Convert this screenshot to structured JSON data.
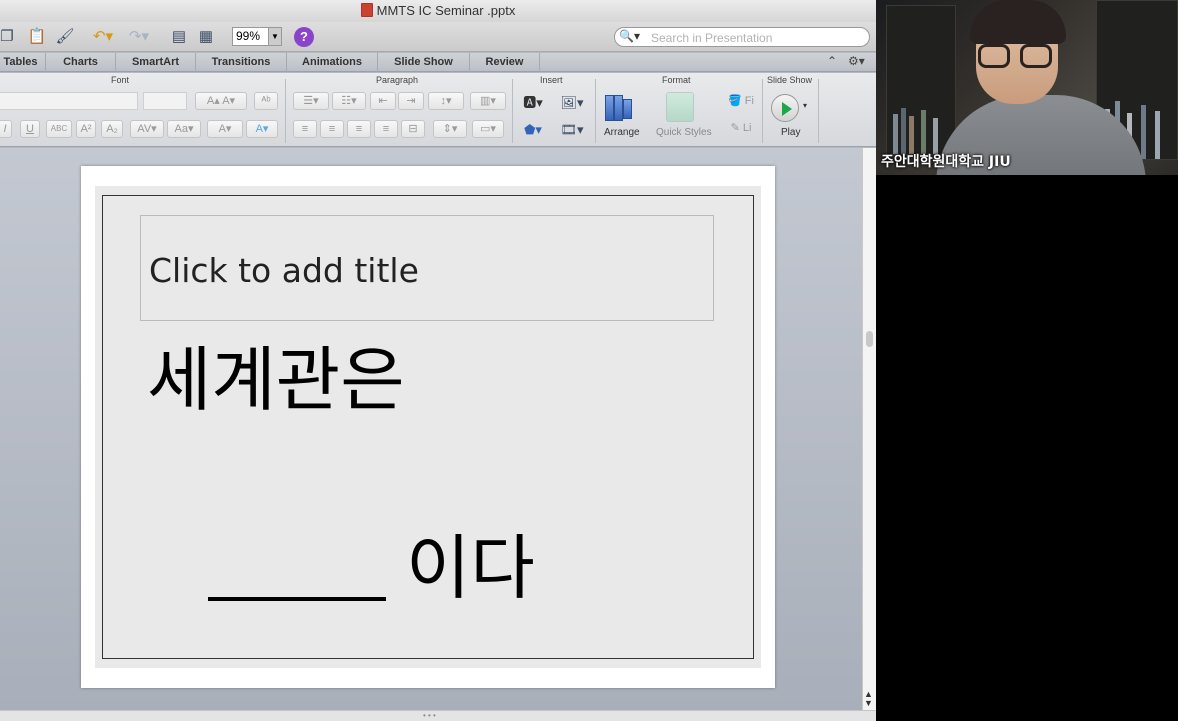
{
  "window": {
    "title": "MMTS IC Seminar .pptx"
  },
  "toolbar": {
    "zoom": "99%",
    "search_placeholder": "Search in Presentation"
  },
  "ribbon_tabs": [
    {
      "label": "Tables"
    },
    {
      "label": "Charts"
    },
    {
      "label": "SmartArt"
    },
    {
      "label": "Transitions"
    },
    {
      "label": "Animations"
    },
    {
      "label": "Slide Show"
    },
    {
      "label": "Review"
    }
  ],
  "ribbon_groups": {
    "font": "Font",
    "paragraph": "Paragraph",
    "insert": "Insert",
    "format": "Format",
    "slide_show": "Slide Show"
  },
  "ribbon_buttons": {
    "arrange": "Arrange",
    "quick_styles": "Quick Styles",
    "play": "Play"
  },
  "slide": {
    "title_placeholder": "Click to add title",
    "line1": "세계관은",
    "line2": "이다"
  },
  "webcam": {
    "caption": "주안대학원대학교 JIU"
  },
  "colors": {
    "play_green": "#1fa54a",
    "help_purple": "#8a44c9",
    "arrange_blue": "#3563b8"
  }
}
